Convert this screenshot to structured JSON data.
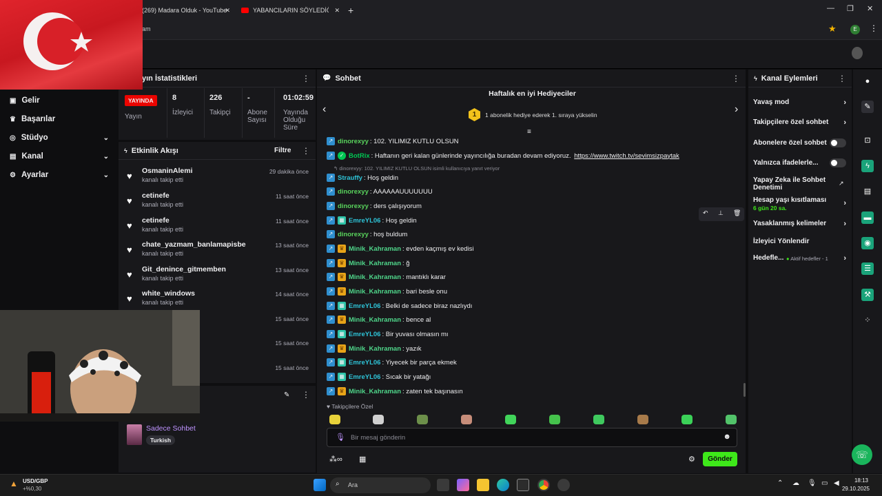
{
  "browser": {
    "tabs": [
      {
        "title": "(269) Madara Olduk - YouTube"
      },
      {
        "title": "YABANCILARIN SÖYLEDİĞİ TÜR"
      }
    ],
    "url_fragment": "am",
    "profile_letter": "E"
  },
  "leftnav": {
    "items": [
      {
        "label": "Gelir",
        "icon": "dollar-icon"
      },
      {
        "label": "Başarılar",
        "icon": "trophy-icon"
      },
      {
        "label": "Stüdyo",
        "icon": "studio-icon",
        "expandable": true
      },
      {
        "label": "Kanal",
        "icon": "channel-icon",
        "expandable": true
      },
      {
        "label": "Ayarlar",
        "icon": "gear-icon",
        "expandable": true
      }
    ]
  },
  "stats": {
    "title": "yın İstatistikleri",
    "live_badge": "YAYINDA",
    "live_label": "Yayın",
    "columns": [
      {
        "value": "8",
        "label": "İzleyici"
      },
      {
        "value": "226",
        "label": "Takipçi"
      },
      {
        "value": "-",
        "label": "Abone Sayısı"
      },
      {
        "value": "01:02:59",
        "label": "Yayında Olduğu Süre"
      }
    ]
  },
  "activity": {
    "title": "Etkinlik Akışı",
    "filter_label": "Filtre",
    "events": [
      {
        "name": "OsmaninAlemi",
        "sub": "kanalı takip etti",
        "time": "29 dakika önce"
      },
      {
        "name": "cetinefe",
        "sub": "kanalı takip etti",
        "time": "11 saat önce"
      },
      {
        "name": "cetinefe",
        "sub": "kanalı takip etti",
        "time": "11 saat önce"
      },
      {
        "name": "chate_yazmam_banlamapisbe",
        "sub": "kanalı takip etti",
        "time": "13 saat önce"
      },
      {
        "name": "Git_denince_gitmemben",
        "sub": "kanalı takip etti",
        "time": "13 saat önce"
      },
      {
        "name": "white_windows",
        "sub": "kanalı takip etti",
        "time": "14 saat önce"
      },
      {
        "name": "",
        "sub": "",
        "time": "15 saat önce"
      },
      {
        "name": "",
        "sub": "",
        "time": "15 saat önce"
      },
      {
        "name": "",
        "sub": "",
        "time": "15 saat önce"
      }
    ]
  },
  "mini_panel": {
    "title": "Sadece Sohbet",
    "tag": "Turkish"
  },
  "chat": {
    "title": "Sohbet",
    "gifters_title": "Haftalık en iyi Hediyeciler",
    "gifters_rank": "1",
    "gifters_text": "1 abonelik hediye ederek 1. sıraya yükselin",
    "reply_note": "dinorexyy: 102. YILIMIZ KUTLU OLSUN isimli kullanıcıya yanıt veriyor",
    "messages": [
      {
        "badges": [
          "blue"
        ],
        "user": "dinorexyy",
        "color": "#59d35c",
        "text": ": 102. YILIMIZ KUTLU OLSUN"
      },
      {
        "badges": [
          "blue",
          "bot"
        ],
        "user": "BotRix",
        "color": "#00c853",
        "text": ": Haftanın geri kalan günlerinde yayıncılığa buradan devam ediyoruz. ",
        "link": "https://www.twitch.tv/sevimsizpaytak"
      },
      {
        "badges": [
          "blue"
        ],
        "user": "Strauffy",
        "color": "#2ec4d8",
        "text": ": Hoş geldin"
      },
      {
        "badges": [
          "blue"
        ],
        "user": "dinorexyy",
        "color": "#59d35c",
        "text": ": AAAAAAUUUUUUU"
      },
      {
        "badges": [
          "blue"
        ],
        "user": "dinorexyy",
        "color": "#59d35c",
        "text": ": ders çalışıyorum"
      },
      {
        "badges": [
          "blue",
          "green"
        ],
        "user": "EmreYL06",
        "color": "#2ec4d8",
        "text": ": Hoş geldin"
      },
      {
        "badges": [
          "blue"
        ],
        "user": "dinorexyy",
        "color": "#59d35c",
        "text": ": hoş buldum"
      },
      {
        "badges": [
          "blue",
          "crown"
        ],
        "user": "Minik_Kahraman",
        "color": "#4fd68a",
        "text": ": evden kaçmış ev kedisi"
      },
      {
        "badges": [
          "blue",
          "crown"
        ],
        "user": "Minik_Kahraman",
        "color": "#4fd68a",
        "text": ": ğ"
      },
      {
        "badges": [
          "blue",
          "crown"
        ],
        "user": "Minik_Kahraman",
        "color": "#4fd68a",
        "text": ": mantıklı karar"
      },
      {
        "badges": [
          "blue",
          "crown"
        ],
        "user": "Minik_Kahraman",
        "color": "#4fd68a",
        "text": ": bari besle onu"
      },
      {
        "badges": [
          "blue",
          "green"
        ],
        "user": "EmreYL06",
        "color": "#2ec4d8",
        "text": ": Belki de sadece biraz nazlıydı"
      },
      {
        "badges": [
          "blue",
          "crown"
        ],
        "user": "Minik_Kahraman",
        "color": "#4fd68a",
        "text": ": bence al"
      },
      {
        "badges": [
          "blue",
          "green"
        ],
        "user": "EmreYL06",
        "color": "#2ec4d8",
        "text": ": Bir yuvası olmasın mı"
      },
      {
        "badges": [
          "blue",
          "crown"
        ],
        "user": "Minik_Kahraman",
        "color": "#4fd68a",
        "text": ": yazık"
      },
      {
        "badges": [
          "blue",
          "green"
        ],
        "user": "EmreYL06",
        "color": "#2ec4d8",
        "text": ": Yiyecek bir parça ekmek"
      },
      {
        "badges": [
          "blue",
          "green"
        ],
        "user": "EmreYL06",
        "color": "#2ec4d8",
        "text": ": Sıcak bir yatağı"
      },
      {
        "badges": [
          "blue",
          "crown"
        ],
        "user": "Minik_Kahraman",
        "color": "#4fd68a",
        "text": ": zaten tek başınasın"
      }
    ],
    "followers_only": "Takipçilere Özel",
    "input_placeholder": "Bir mesaj gönderin",
    "send_label": "Gönder"
  },
  "channel_actions": {
    "title": "Kanal Eylemleri",
    "items": [
      {
        "label": "Yavaş mod",
        "control": "chevron"
      },
      {
        "label": "Takipçilere özel sohbet",
        "control": "chevron"
      },
      {
        "label": "Abonelere özel sohbet",
        "control": "toggle"
      },
      {
        "label": "Yalnızca ifadelerle...",
        "control": "toggle"
      },
      {
        "label": "Yapay Zeka ile Sohbet Denetimi",
        "control": "external"
      },
      {
        "label": "Hesap yaşı kısıtlaması",
        "sub": "6 gün 20 sa.",
        "control": "chevron"
      },
      {
        "label": "Yasaklanmış kelimeler",
        "control": "chevron"
      },
      {
        "label": "İzleyici Yönlendir",
        "control": "none"
      },
      {
        "label": "Hedefle...",
        "sub": "Aktif hedefler - 1",
        "control": "chevron"
      }
    ]
  },
  "taskbar": {
    "ticker_label": "USD/GBP",
    "ticker_value": "+%0,30",
    "search_placeholder": "Ara",
    "time": "18:13",
    "date": "29.10.2025"
  },
  "colors": {
    "accent_purple": "#9147ff",
    "live_red": "#eb0400",
    "send_green": "#3ee81a"
  }
}
